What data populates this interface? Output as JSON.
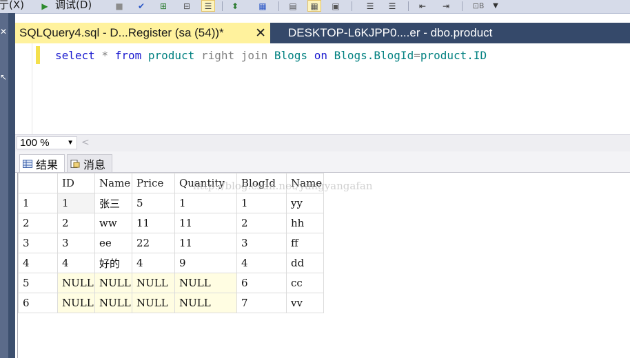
{
  "menu": {
    "partial_left": "亍(X)",
    "debug": "调试(D)"
  },
  "toolbar": {
    "dropdown_glyph": "⊡B"
  },
  "tabs": {
    "active_title": "SQLQuery4.sql - D...Register (sa (54))*",
    "close_glyph": "✕",
    "inactive_title": "DESKTOP-L6KJPP0....er - dbo.product"
  },
  "editor": {
    "kw_select": "select",
    "star": " * ",
    "kw_from": "from",
    "table_product": " product ",
    "right_join": "right join",
    "table_blogs": " Blogs ",
    "kw_on": "on",
    "cond_left": " Blogs.BlogId",
    "eq": "=",
    "cond_right": "product.ID"
  },
  "zoom": {
    "value": "100 %"
  },
  "result_tabs": {
    "results": "结果",
    "messages": "消息"
  },
  "grid": {
    "headers": [
      "ID",
      "Name",
      "Price",
      "Quantity",
      "BlogId",
      "Name"
    ],
    "rows": [
      {
        "num": "1",
        "cells": [
          "1",
          "张三",
          "5",
          "1",
          "1",
          "yy"
        ]
      },
      {
        "num": "2",
        "cells": [
          "2",
          "ww",
          "11",
          "11",
          "2",
          "hh"
        ]
      },
      {
        "num": "3",
        "cells": [
          "3",
          "ee",
          "22",
          "11",
          "3",
          "ff"
        ]
      },
      {
        "num": "4",
        "cells": [
          "4",
          "好的",
          "4",
          "9",
          "4",
          "dd"
        ]
      },
      {
        "num": "5",
        "cells": [
          "NULL",
          "NULL",
          "NULL",
          "NULL",
          "6",
          "cc"
        ]
      },
      {
        "num": "6",
        "cells": [
          "NULL",
          "NULL",
          "NULL",
          "NULL",
          "7",
          "vv"
        ]
      }
    ]
  },
  "watermark": "http://blog.csdn.net/yangyangafan",
  "colors": {
    "active_tab": "#fff29d",
    "tabbar": "#35496a",
    "null_cell": "#fffde2",
    "keyword": "#1a1acf",
    "identifier": "#008080"
  }
}
